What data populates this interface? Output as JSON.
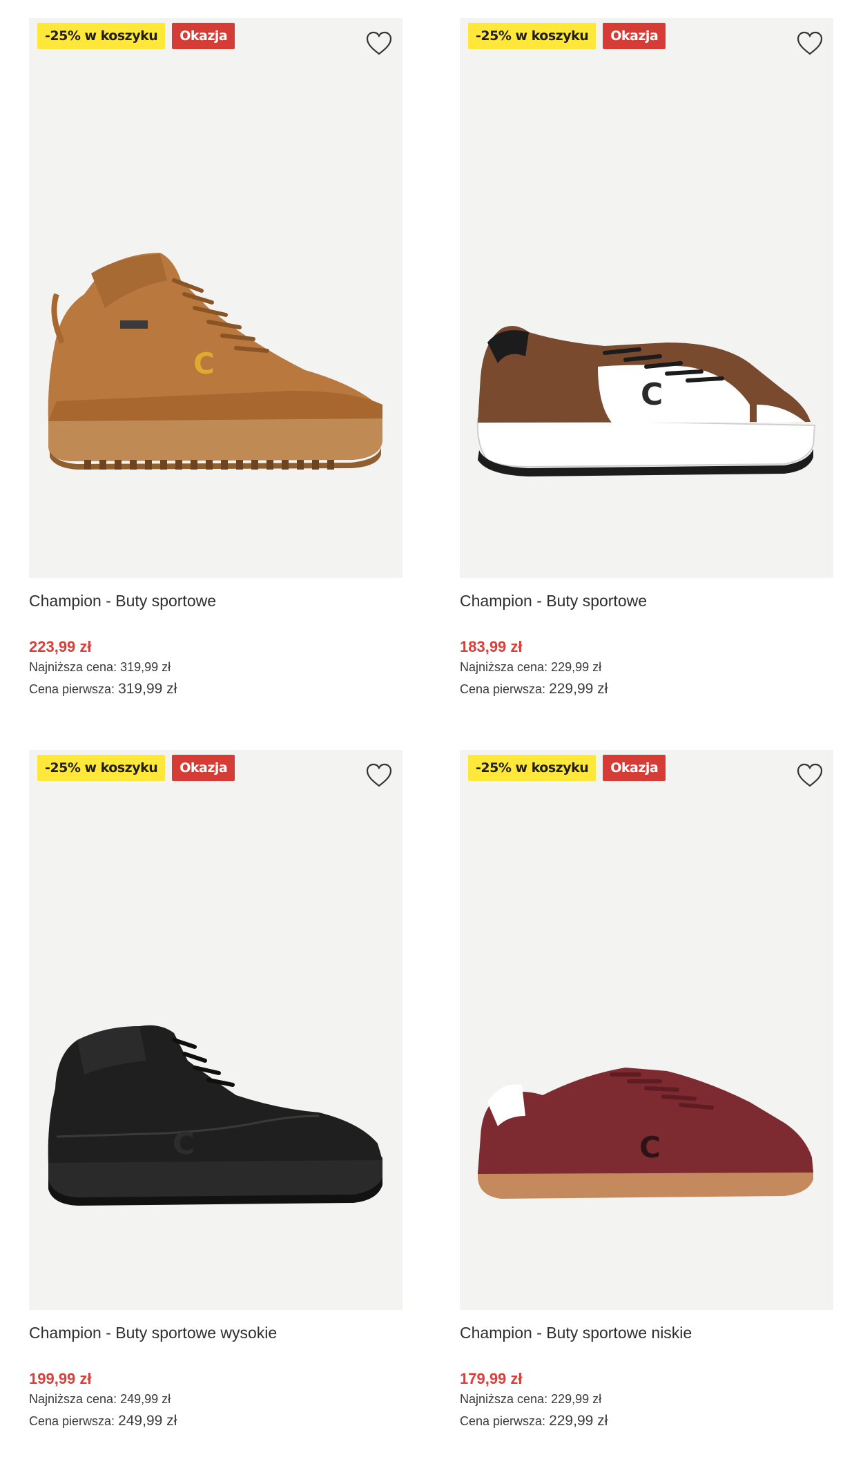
{
  "products": [
    {
      "badge_promo": "-25% w koszyku",
      "badge_deal": "Okazja",
      "title": "Champion - Buty sportowe",
      "price": "223,99 zł",
      "lowest_label": "Najniższa cena:",
      "lowest_value": "319,99 zł",
      "first_label": "Cena pierwsza:",
      "first_value": "319,99 zł",
      "shoe_color": "#b9783d"
    },
    {
      "badge_promo": "-25% w koszyku",
      "badge_deal": "Okazja",
      "title": "Champion - Buty sportowe",
      "price": "183,99 zł",
      "lowest_label": "Najniższa cena:",
      "lowest_value": "229,99 zł",
      "first_label": "Cena pierwsza:",
      "first_value": "229,99 zł",
      "shoe_color": "#7a4a2e"
    },
    {
      "badge_promo": "-25% w koszyku",
      "badge_deal": "Okazja",
      "title": "Champion - Buty sportowe wysokie",
      "price": "199,99 zł",
      "lowest_label": "Najniższa cena:",
      "lowest_value": "249,99 zł",
      "first_label": "Cena pierwsza:",
      "first_value": "249,99 zł",
      "shoe_color": "#1f1f1f"
    },
    {
      "badge_promo": "-25% w koszyku",
      "badge_deal": "Okazja",
      "title": "Champion - Buty sportowe niskie",
      "price": "179,99 zł",
      "lowest_label": "Najniższa cena:",
      "lowest_value": "229,99 zł",
      "first_label": "Cena pierwsza:",
      "first_value": "229,99 zł",
      "shoe_color": "#7e2a31"
    }
  ],
  "icons": {
    "wishlist": "heart-outline-icon"
  },
  "colors": {
    "price_red": "#d9403b",
    "promo_yellow": "#ffe83a",
    "deal_red": "#d63c36",
    "image_bg": "#f3f3f2"
  }
}
